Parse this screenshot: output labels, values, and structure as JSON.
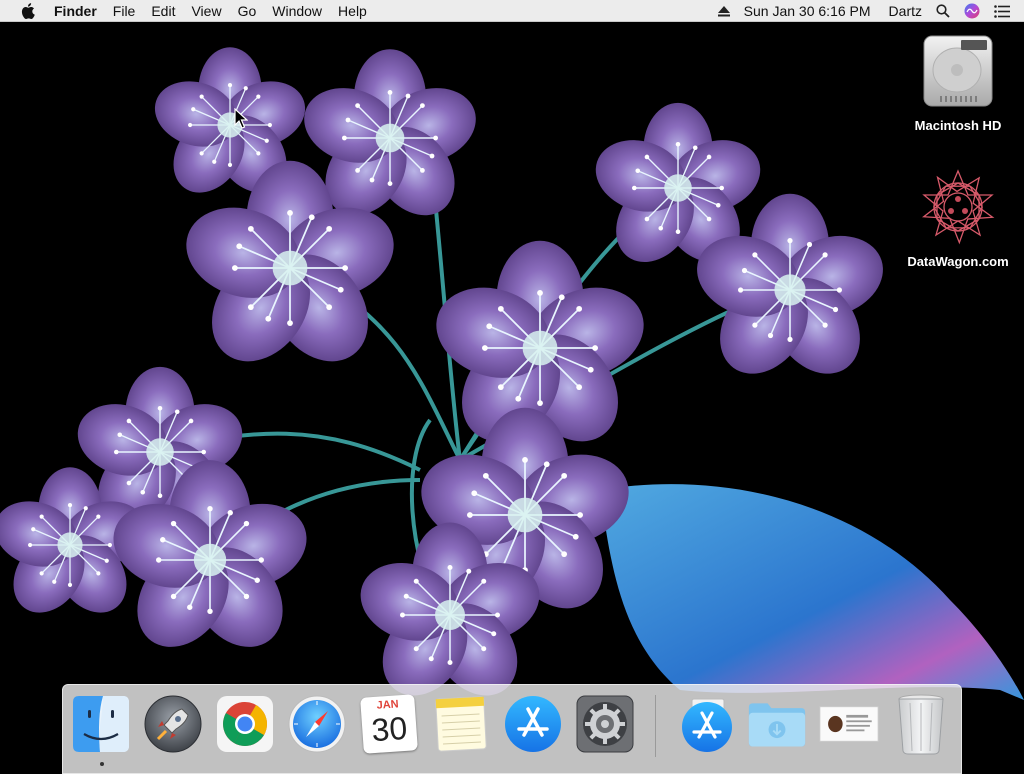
{
  "menubar": {
    "apple_icon": "apple-logo-icon",
    "app_name": "Finder",
    "menus": [
      "File",
      "Edit",
      "View",
      "Go",
      "Window",
      "Help"
    ],
    "clock": "Sun Jan 30  6:16 PM",
    "user": "Dartz",
    "status_icons": [
      "eject-icon",
      "search-icon",
      "siri-icon",
      "notification-list-icon"
    ]
  },
  "desktop": {
    "icons": [
      {
        "label": "Macintosh HD",
        "icon": "hard-drive-icon"
      },
      {
        "label": "DataWagon.com",
        "icon": "star-pattern-icon"
      }
    ]
  },
  "dock": {
    "apps": [
      {
        "name": "Finder",
        "icon": "finder-icon",
        "running": true
      },
      {
        "name": "Launchpad",
        "icon": "launchpad-rocket-icon",
        "running": false
      },
      {
        "name": "Google Chrome",
        "icon": "chrome-icon",
        "running": false
      },
      {
        "name": "Safari",
        "icon": "safari-compass-icon",
        "running": false
      },
      {
        "name": "Calendar",
        "icon": "calendar-icon",
        "running": false,
        "month": "JAN",
        "day": "30"
      },
      {
        "name": "Notes",
        "icon": "notes-icon",
        "running": false
      },
      {
        "name": "App Store",
        "icon": "app-store-icon",
        "running": false
      },
      {
        "name": "System Preferences",
        "icon": "gear-icon",
        "running": false
      }
    ],
    "others": [
      {
        "name": "App Store",
        "icon": "app-store-icon"
      },
      {
        "name": "Downloads",
        "icon": "downloads-folder-icon"
      },
      {
        "name": "Document",
        "icon": "document-preview-icon"
      },
      {
        "name": "Trash",
        "icon": "trash-icon"
      }
    ]
  },
  "colors": {
    "menubar_bg": "#ececec",
    "petal": "#7a5aa8",
    "stem": "#3fa8a8",
    "leaf": "#3d8fe0"
  }
}
